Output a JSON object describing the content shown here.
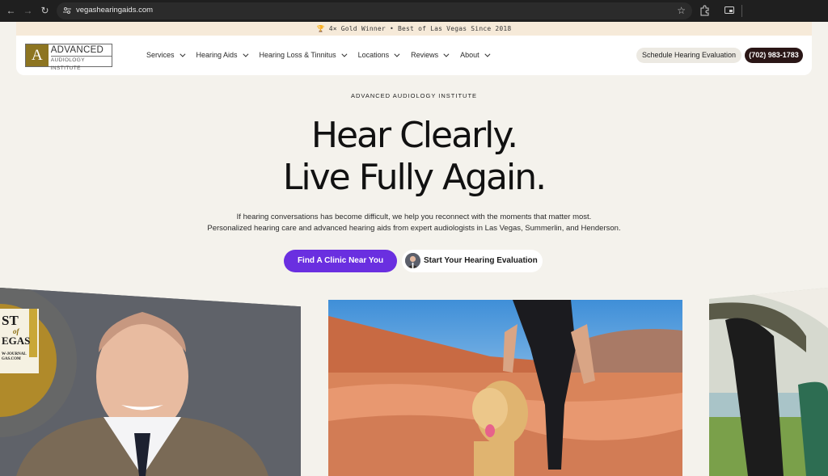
{
  "browser": {
    "url": "vegashearingaids.com"
  },
  "announcement": {
    "text": "🏆 4× Gold Winner • Best of Las Vegas Since 2018"
  },
  "header": {
    "logo": {
      "mark": "A",
      "line1": "ADVANCED",
      "line2": "AUDIOLOGY INSTITUTE"
    },
    "nav": [
      {
        "label": "Services"
      },
      {
        "label": "Hearing Aids"
      },
      {
        "label": "Hearing Loss & Tinnitus"
      },
      {
        "label": "Locations"
      },
      {
        "label": "Reviews"
      },
      {
        "label": "About"
      }
    ],
    "eval_button": "Schedule Hearing Evaluation",
    "phone_button": "(702) 983-1783"
  },
  "hero": {
    "eyebrow": "ADVANCED AUDIOLOGY INSTITUTE",
    "headline_line1": "Hear Clearly.",
    "headline_line2": "Live Fully Again.",
    "subtext_line1": "If hearing conversations has become difficult, we help you reconnect with the moments that matter most.",
    "subtext_line2": "Personalized hearing care and advanced hearing aids from expert audiologists in Las Vegas, Summerlin, and Henderson.",
    "cta_primary": "Find A Clinic Near You",
    "cta_secondary": "Start Your Hearing Evaluation"
  },
  "gallery": {
    "badge_lines": [
      "ST",
      "of",
      "EGAS",
      "W-JOURNAL",
      "GAS.COM"
    ]
  },
  "colors": {
    "accent_purple": "#6a2fe0",
    "phone_button_bg": "#2a1616",
    "logo_gold": "#8d7521",
    "page_bg": "#f4f2ec",
    "announcement_bg": "#f6ead9"
  }
}
